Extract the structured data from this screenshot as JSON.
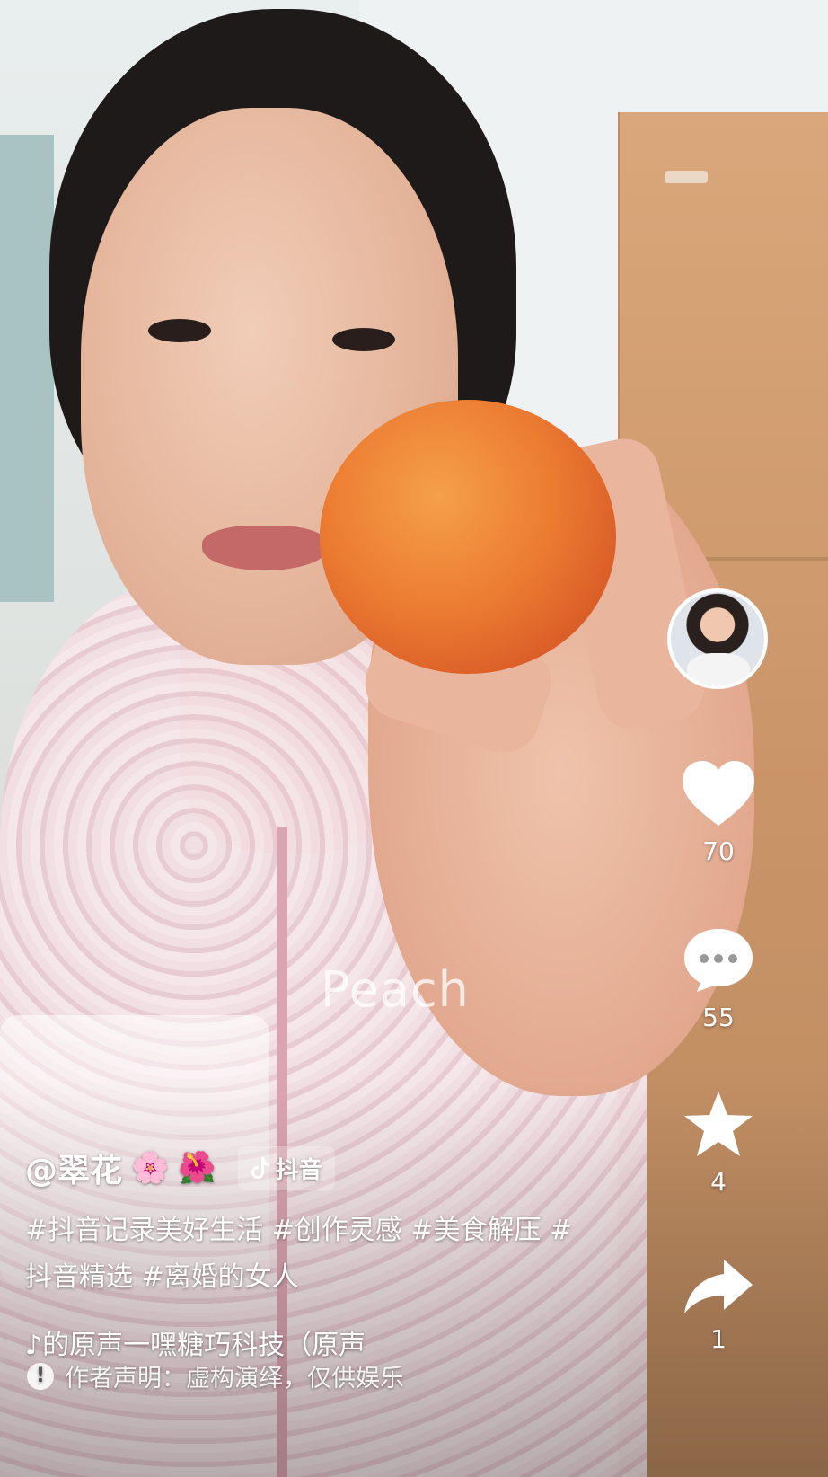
{
  "video": {
    "overlay_text": "Peach"
  },
  "author": {
    "handle": "@翠花",
    "emoji1": "🌸",
    "emoji2": "🌺",
    "platform_badge": "抖音"
  },
  "description": "#抖音记录美好生活 #创作灵感 #美食解压 #抖音精选 #离婚的女人",
  "music": {
    "icon": "music-note-icon",
    "text": "♪的原声一嘿糖巧科技（原声"
  },
  "disclaimer": "作者声明：虚构演绎，仅供娱乐",
  "actions": {
    "likes": "70",
    "comments": "55",
    "favorites": "4",
    "shares": "1"
  },
  "colors": {
    "icon": "#ffffff",
    "peach": "#ec7c32"
  }
}
